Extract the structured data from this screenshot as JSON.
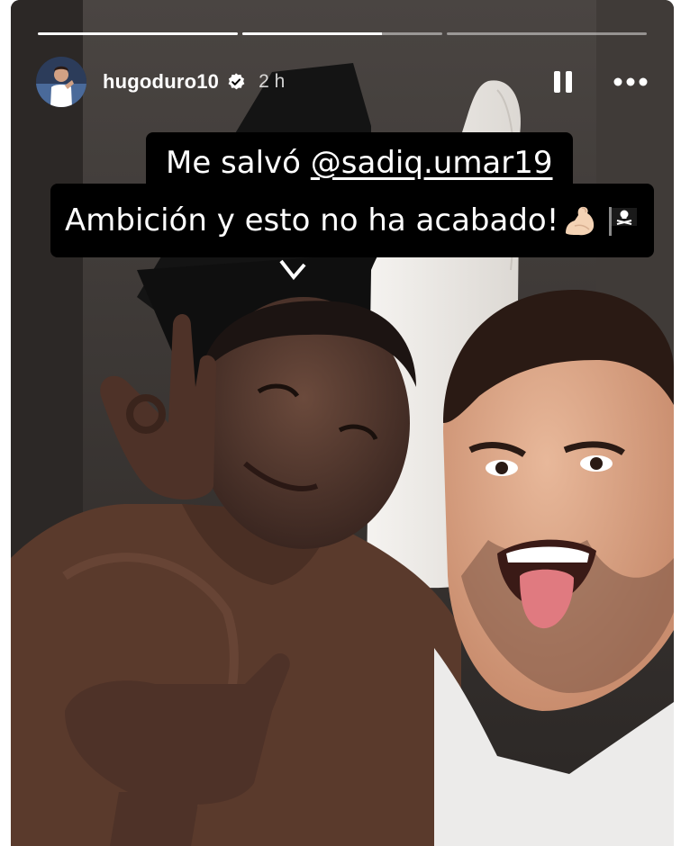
{
  "story": {
    "username": "hugoduro10",
    "time_ago": "2 h",
    "progress": [
      1.0,
      0.7,
      0.0
    ]
  },
  "caption": {
    "line1_prefix": "Me salvó ",
    "mention": "@sadiq.umar19",
    "line2": "Ambición y esto no ha acabado!",
    "emoji_icons": [
      "flexed-biceps-icon",
      "pirate-flag-icon"
    ]
  },
  "icons": {
    "verified": "verified-badge-icon",
    "pause": "pause-icon",
    "more": "more-dots-icon"
  },
  "colors": {
    "verified": "#ffffff",
    "caption_bg": "#000000",
    "caption_text": "#ffffff"
  }
}
